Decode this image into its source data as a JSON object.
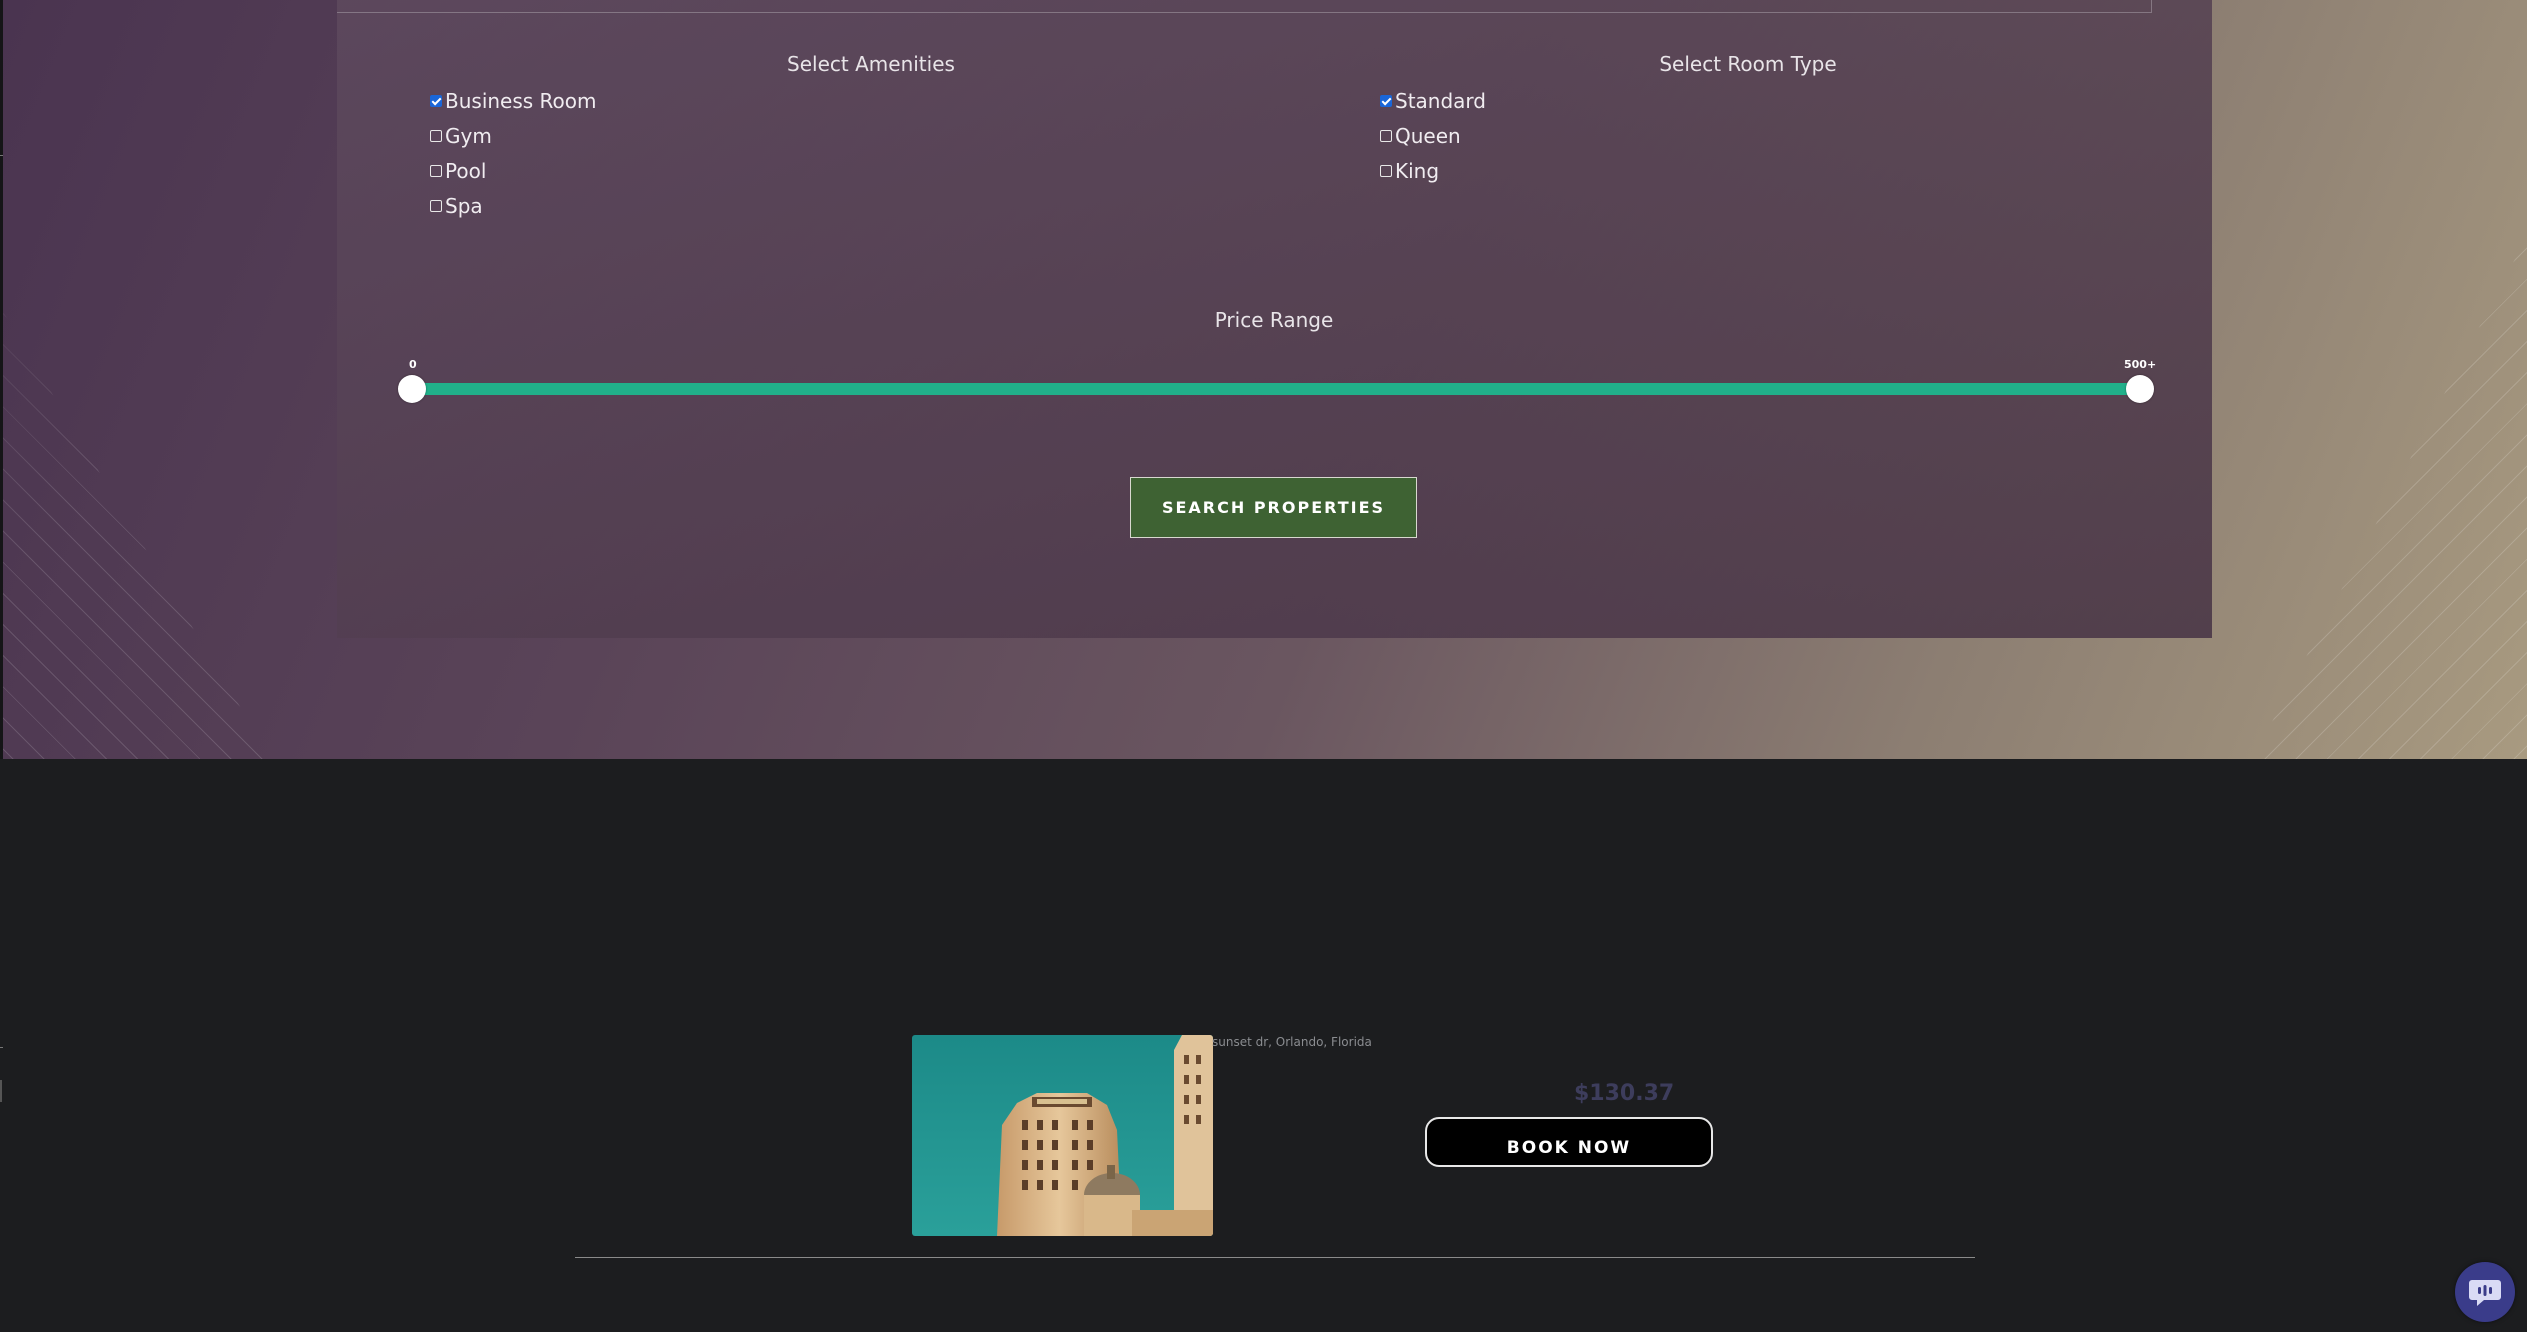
{
  "filters": {
    "amenities_title": "Select Amenities",
    "amenities": [
      {
        "label": "Business Room",
        "checked": true
      },
      {
        "label": "Gym",
        "checked": false
      },
      {
        "label": "Pool",
        "checked": false
      },
      {
        "label": "Spa",
        "checked": false
      }
    ],
    "room_type_title": "Select Room Type",
    "room_types": [
      {
        "label": "Standard",
        "checked": true
      },
      {
        "label": "Queen",
        "checked": false
      },
      {
        "label": "King",
        "checked": false
      }
    ],
    "price_title": "Price Range",
    "price_min_label": "0",
    "price_max_label": "500+",
    "price_range_fraction": [
      0,
      1
    ],
    "search_label": "SEARCH PROPERTIES"
  },
  "listing": {
    "address": "sunset dr, Orlando, Florida",
    "price": "$130.37",
    "book_label": "BOOK NOW",
    "image_icon": "hotel-building-photo"
  },
  "colors": {
    "slider": "#21b08a",
    "search_button": "#3e6233",
    "price_text": "#3d3d5c",
    "chat_button": "#3a3c8a",
    "checkbox_checked": "#1a66d8"
  },
  "icons": {
    "chat": "chat-bubble-icon"
  }
}
